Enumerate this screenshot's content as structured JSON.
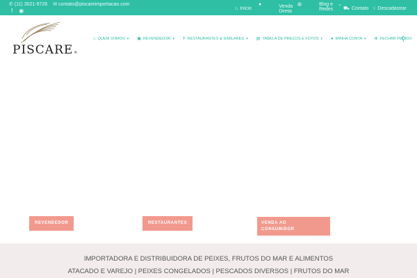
{
  "topbar": {
    "phone": "(11) 3021-9726",
    "email": "contato@piscareimportacao.com",
    "social": {
      "facebook_icon": "facebook-icon",
      "rss_icon": "rss-icon"
    },
    "nav": [
      {
        "label": "Início",
        "icon": "home-icon"
      },
      {
        "label": "Venda Direta",
        "icon": "user-icon"
      },
      {
        "label": "Blog e Redes",
        "icon": "blog-icon"
      },
      {
        "label": "Contato",
        "icon": "cart-icon"
      },
      {
        "label": "Descadastrar",
        "icon": "thumbs-down-icon"
      }
    ]
  },
  "logo": {
    "text": "PISCARE",
    "mark": "®"
  },
  "mainnav": [
    {
      "label": "QUEM SOMOS",
      "icon": "home-icon"
    },
    {
      "label": "REVENDEDOR",
      "icon": "store-icon"
    },
    {
      "label": "RESTAURANTES & SIMILARES",
      "icon": "cutlery-icon"
    },
    {
      "label": "TABELA DE PREÇOS E FOTOS",
      "icon": "table-icon"
    },
    {
      "label": "MINHA CONTA",
      "icon": "user-icon"
    },
    {
      "label": "FECHAR PEDIDO",
      "icon": "checkout-icon"
    }
  ],
  "hero": {
    "buttons": {
      "revendedor": "REVENDEDOR",
      "restaurantes": "RESTAURANTES",
      "venda_line1": "VENDA AO",
      "venda_line2": "CONSUMIDOR"
    }
  },
  "band": {
    "line1": "IMPORTADORA E DISTRIBUIDORA DE PEIXES, FRUTOS DO MAR E ALIMENTOS",
    "line2": "ATACADO E VAREJO | PEIXES CONGELADOS | PESCADOS DIVERSOS | FRUTOS DO MAR"
  },
  "colors": {
    "teal": "#2ebfa5",
    "salmon": "#f2998d",
    "band": "#f2ecec"
  }
}
